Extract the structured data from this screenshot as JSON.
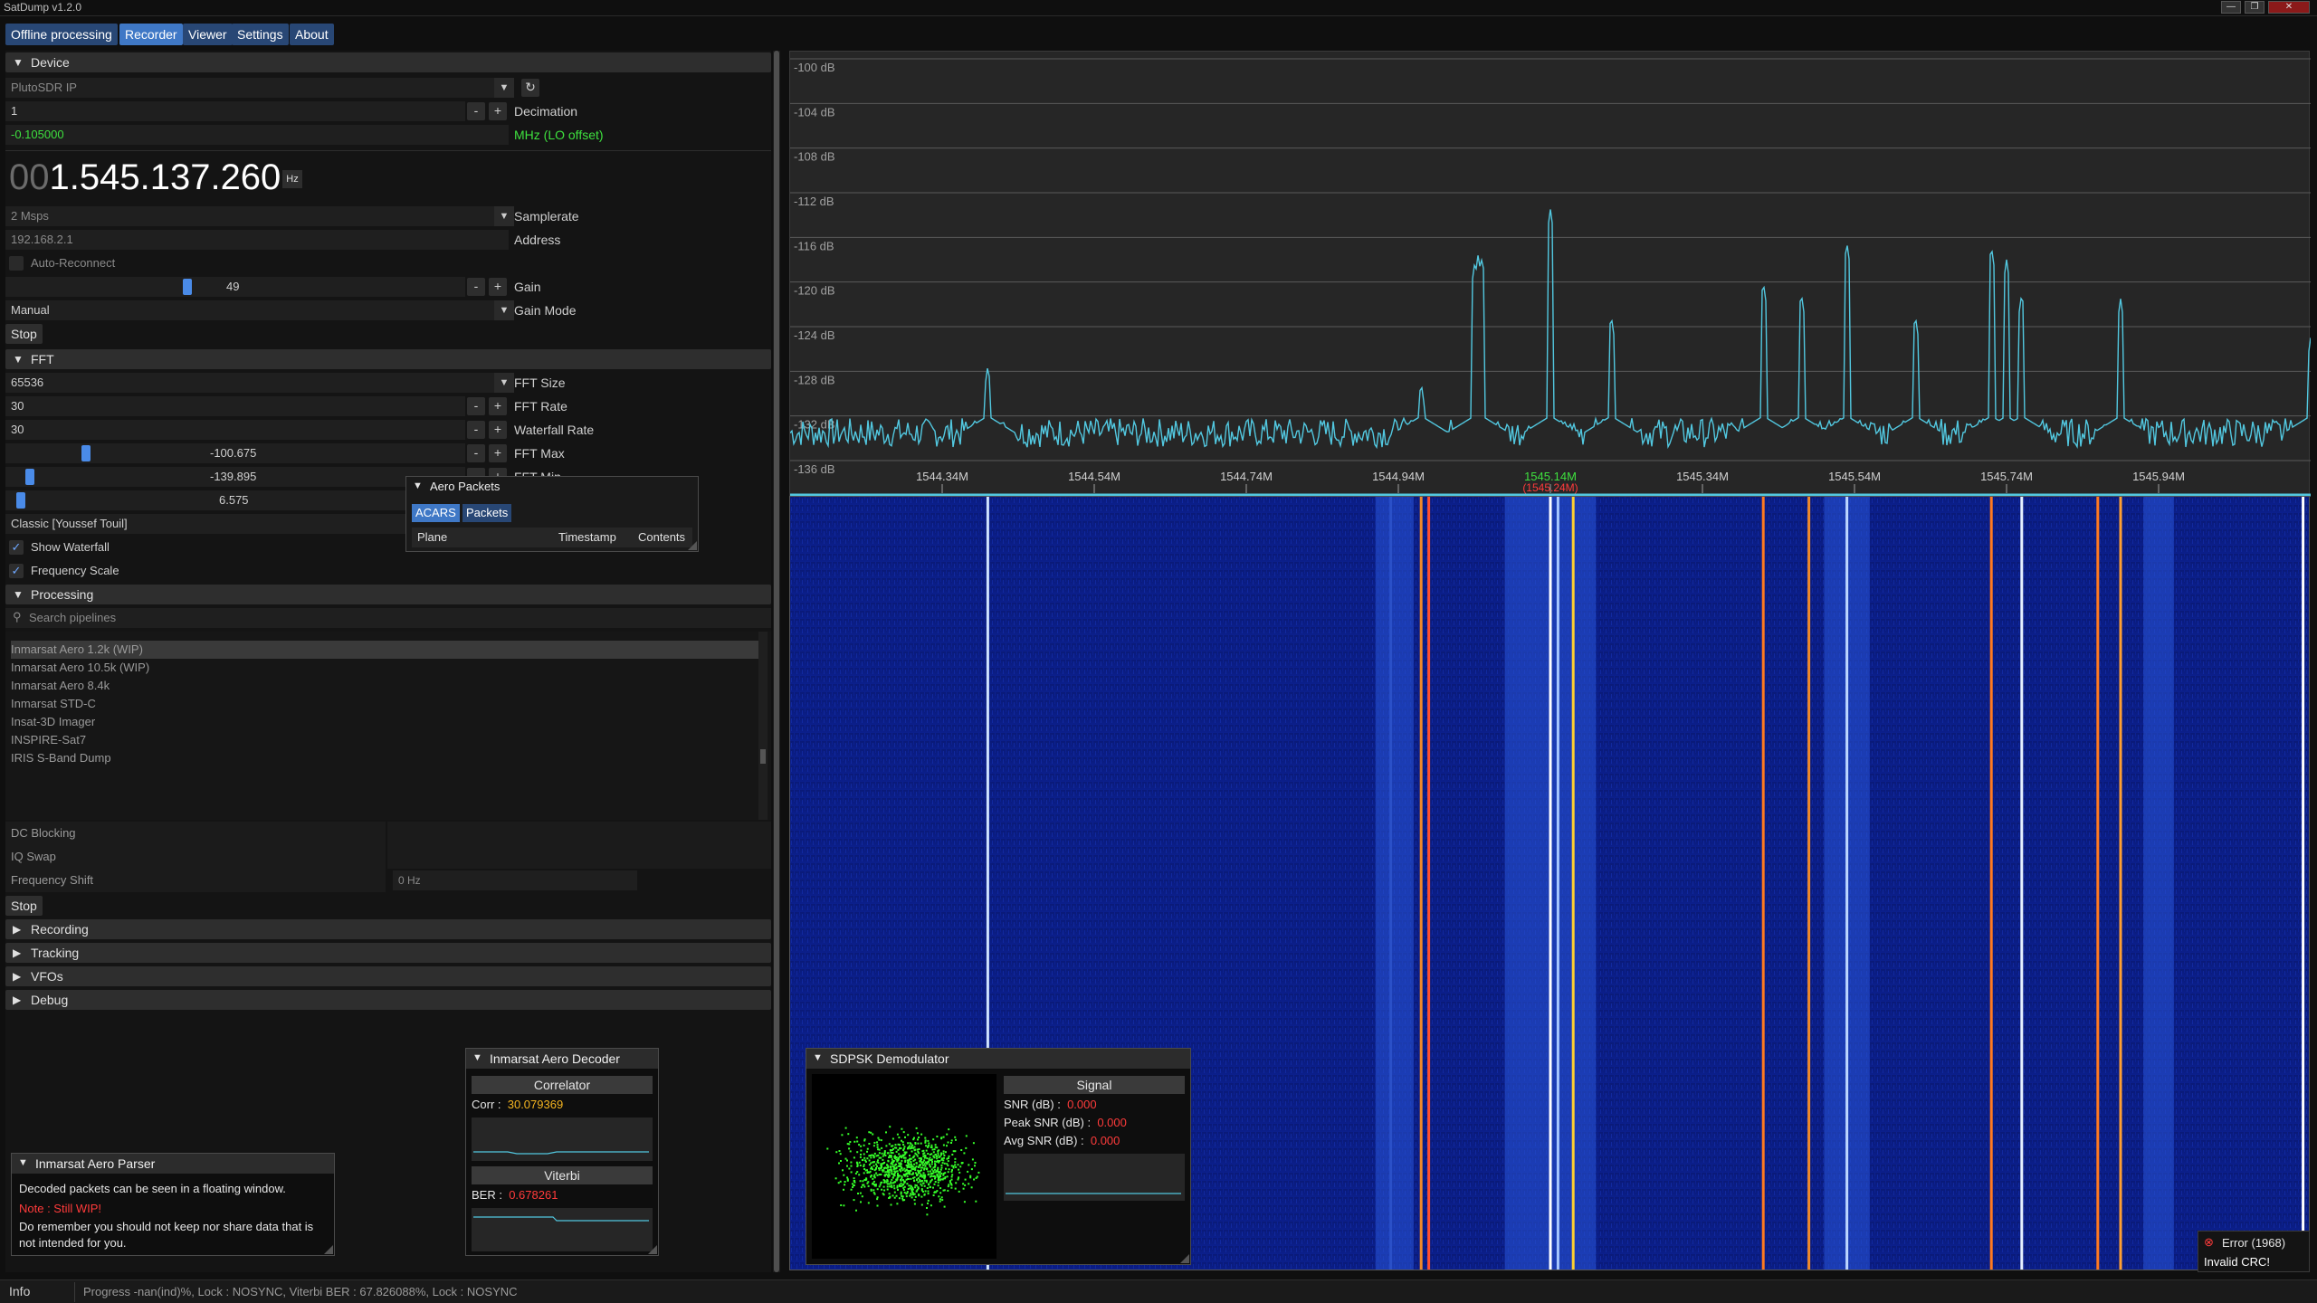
{
  "app": {
    "title": "SatDump v1.2.0",
    "window_buttons": [
      "—",
      "❐",
      "✕"
    ]
  },
  "tabs": [
    {
      "label": "Offline processing",
      "active": false
    },
    {
      "label": "Recorder",
      "active": true
    },
    {
      "label": "Viewer",
      "active": false
    },
    {
      "label": "Settings",
      "active": false
    },
    {
      "label": "About",
      "active": false
    }
  ],
  "device": {
    "header": "Device",
    "source": "PlutoSDR IP",
    "decimation_value": "1",
    "decimation_label": "Decimation",
    "lo_offset_value": "-0.105000",
    "lo_offset_label": "MHz (LO offset)",
    "freq_prefix": "00",
    "freq_main": "1.545.137.260",
    "freq_unit": "Hz",
    "samplerate_value": "2 Msps",
    "samplerate_label": "Samplerate",
    "address_value": "192.168.2.1",
    "address_label": "Address",
    "auto_reconnect": "Auto-Reconnect",
    "gain_value": "49",
    "gain_label": "Gain",
    "gain_level": 0.49,
    "gain_mode_value": "Manual",
    "gain_mode_label": "Gain Mode",
    "stop": "Stop"
  },
  "fft": {
    "header": "FFT",
    "size_value": "65536",
    "size_label": "FFT Size",
    "rate_value": "30",
    "rate_label": "FFT Rate",
    "wf_rate_value": "30",
    "wf_rate_label": "Waterfall Rate",
    "max_value": "-100.675",
    "max_label": "FFT Max",
    "min_value": "-139.895",
    "min_label": "FFT Min",
    "avg_value": "6.575",
    "palette": "Classic [Youssef Touil]",
    "show_waterfall": "Show Waterfall",
    "frequency_scale": "Frequency Scale"
  },
  "processing": {
    "header": "Processing",
    "search_placeholder": "Search pipelines",
    "pipelines": [
      "Inmarsat Aero 1.2k (WIP)",
      "Inmarsat Aero 10.5k (WIP)",
      "Inmarsat Aero 8.4k",
      "Inmarsat STD-C",
      "Insat-3D Imager",
      "INSPIRE-Sat7",
      "IRIS S-Band Dump"
    ],
    "selected_pipeline": 0,
    "dc_blocking": "DC Blocking",
    "iq_swap": "IQ Swap",
    "frequency_shift": "Frequency Shift",
    "frequency_shift_value": "0 Hz",
    "stop": "Stop"
  },
  "collapsed_sections": [
    "Recording",
    "Tracking",
    "VFOs",
    "Debug"
  ],
  "aero_packets": {
    "title": "Aero Packets",
    "tabs": [
      "ACARS",
      "Packets"
    ],
    "columns": [
      "Plane",
      "Timestamp",
      "Contents"
    ]
  },
  "aero_parser": {
    "title": "Inmarsat Aero Parser",
    "line1": "Decoded packets can be seen in a floating window.",
    "note": "Note : Still WIP!",
    "line2": "Do remember you should not keep nor share data that is not intended for you."
  },
  "aero_decoder": {
    "title": "Inmarsat Aero Decoder",
    "correlator": "Correlator",
    "corr_label": "Corr :",
    "corr_value": "30.079369",
    "viterbi": "Viterbi",
    "ber_label": "BER :",
    "ber_value": "0.678261"
  },
  "sdpsk": {
    "title": "SDPSK Demodulator",
    "signal": "Signal",
    "snr_label": "SNR (dB) :",
    "snr_value": "0.000",
    "peak_label": "Peak SNR (dB) :",
    "peak_value": "0.000",
    "avg_label": "Avg SNR (dB) :",
    "avg_value": "0.000"
  },
  "error": {
    "title": "Error (1968)",
    "message": "Invalid CRC!"
  },
  "status": {
    "label": "Info",
    "text": "Progress -nan(ind)%, Lock : NOSYNC, Viterbi BER : 67.826088%, Lock : NOSYNC"
  },
  "chart_data": {
    "type": "line",
    "ylabel_ticks": [
      "-100 dB",
      "-104 dB",
      "-108 dB",
      "-112 dB",
      "-116 dB",
      "-120 dB",
      "-124 dB",
      "-128 dB",
      "-132 dB",
      "-136 dB"
    ],
    "ylim": [
      -136,
      -100
    ],
    "xlim_mhz": [
      1544.14,
      1546.14
    ],
    "x_ticks": [
      "1544.34M",
      "1544.54M",
      "1544.74M",
      "1544.94M",
      "1545.14M",
      "1545.34M",
      "1545.54M",
      "1545.74M",
      "1545.94M"
    ],
    "center_label": "1545.14M",
    "tuned_label": "(1545.24M)",
    "noise_floor_db": -133.5,
    "series": [
      {
        "x": [
          1544.4,
          1544.97,
          1545.04,
          1545.045,
          1545.05,
          1545.14,
          1545.22,
          1545.42,
          1545.47,
          1545.53,
          1545.62,
          1545.72,
          1545.74,
          1545.76,
          1545.89,
          1546.14
        ],
        "y": [
          -127.5,
          -129.0,
          -118.5,
          -117.5,
          -117.8,
          -113.5,
          -123.0,
          -120.0,
          -121.0,
          -116.5,
          -123.0,
          -116.8,
          -118.0,
          -121.0,
          -121.5,
          -125.0
        ]
      }
    ],
    "waterfall_lines": [
      {
        "x": 1544.4,
        "color": "#cfe3ff"
      },
      {
        "x": 1544.93,
        "color": "#2a50c8"
      },
      {
        "x": 1544.97,
        "color": "#f08a2a"
      },
      {
        "x": 1544.98,
        "color": "#ff5030"
      },
      {
        "x": 1545.14,
        "color": "#ffffff"
      },
      {
        "x": 1545.15,
        "color": "#a8c8ff"
      },
      {
        "x": 1545.17,
        "color": "#ffd030"
      },
      {
        "x": 1545.42,
        "color": "#ff7a20"
      },
      {
        "x": 1545.48,
        "color": "#f08a2a"
      },
      {
        "x": 1545.53,
        "color": "#bcd6ff"
      },
      {
        "x": 1545.72,
        "color": "#ff7a20"
      },
      {
        "x": 1545.76,
        "color": "#e6f0ff"
      },
      {
        "x": 1545.86,
        "color": "#ff7a20"
      },
      {
        "x": 1545.89,
        "color": "#ffa030"
      },
      {
        "x": 1546.13,
        "color": "#ffffff"
      }
    ],
    "waterfall_bands": [
      {
        "x0": 1544.91,
        "x1": 1544.96
      },
      {
        "x0": 1545.08,
        "x1": 1545.2
      },
      {
        "x0": 1545.5,
        "x1": 1545.56
      },
      {
        "x0": 1545.92,
        "x1": 1545.96
      }
    ]
  }
}
